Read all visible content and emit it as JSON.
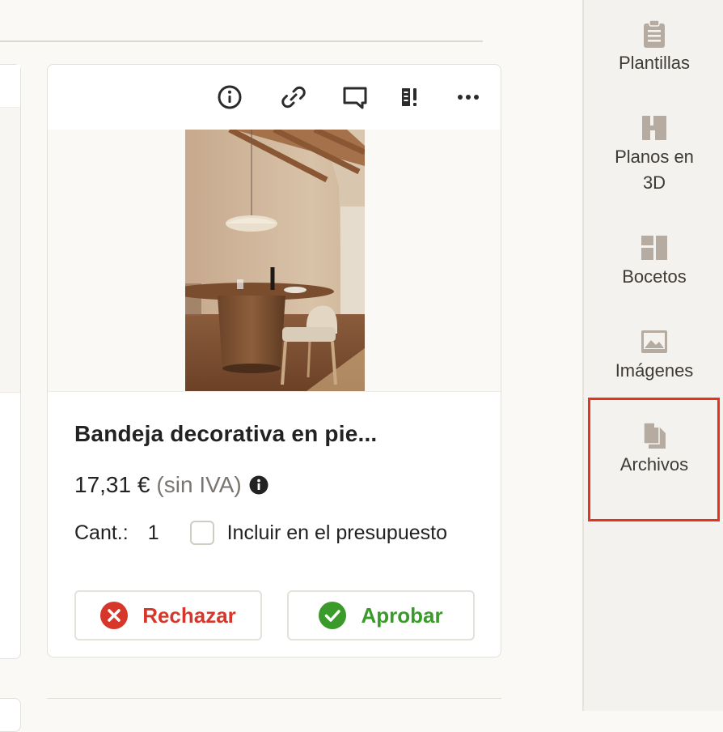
{
  "card": {
    "toolbar": {
      "icons": [
        "info-icon",
        "link-icon",
        "comment-icon",
        "compare-icon",
        "more-icon"
      ]
    },
    "image_alt": "Comedor con mesa redonda de madera, silla y lámpara colgante",
    "title": "Bandeja decorativa en pie...",
    "price": "17,31 €",
    "price_tax_note": "(sin IVA)",
    "quantity_label": "Cant.:",
    "quantity_value": "1",
    "include_budget_label": "Incluir en el presupuesto",
    "include_budget_checked": false,
    "reject_label": "Rechazar",
    "approve_label": "Aprobar"
  },
  "sidebar": {
    "items": [
      {
        "label": "Plantillas",
        "icon": "clipboard-icon"
      },
      {
        "label": "Planos en 3D",
        "icon": "floorplan-icon"
      },
      {
        "label": "Bocetos",
        "icon": "sketches-icon"
      },
      {
        "label": "Imágenes",
        "icon": "image-icon"
      },
      {
        "label": "Archivos",
        "icon": "files-icon",
        "highlighted": true
      }
    ]
  },
  "colors": {
    "reject": "#d7372a",
    "approve": "#3a9a2a",
    "icon_muted": "#b5aba0",
    "highlight": "#e8321e"
  }
}
